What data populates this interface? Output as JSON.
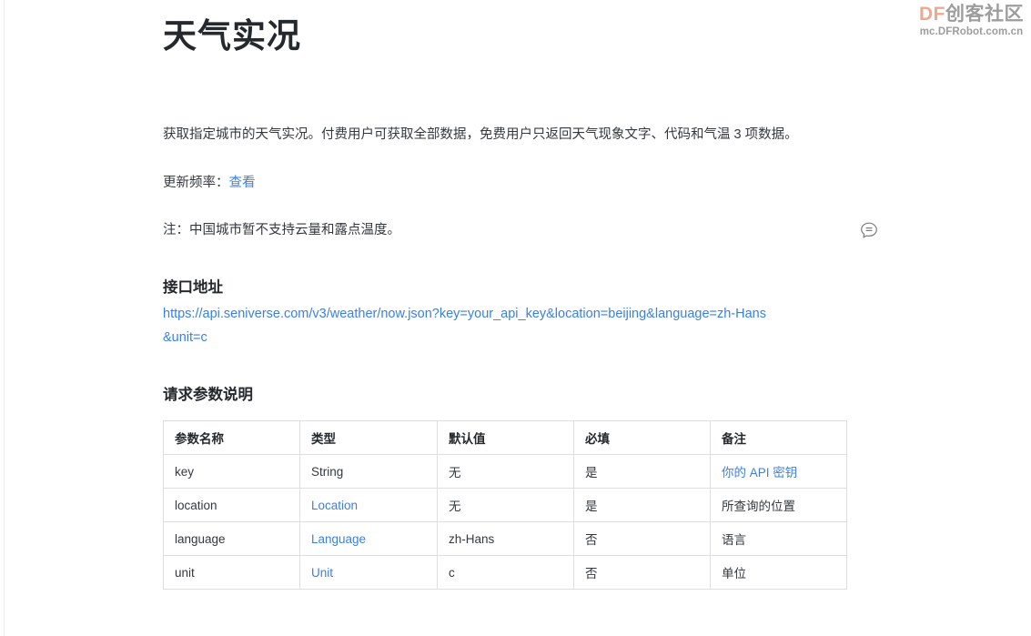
{
  "watermark": {
    "brand_df": "DF",
    "brand_cn": "创客社区",
    "site": "mc.DFRobot.com.cn",
    "df_color": "#eda98f",
    "cn_color": "#9d9d9d"
  },
  "doc": {
    "title": "天气实况",
    "intro": "获取指定城市的天气实况。付费用户可获取全部数据，免费用户只返回天气现象文字、代码和气温 3 项数据。",
    "frequency_label": "更新频率：",
    "frequency_link": "查看",
    "note": "注：中国城市暂不支持云量和露点温度。"
  },
  "endpoint": {
    "heading": "接口地址",
    "url": "https://api.seniverse.com/v3/weather/now.json?key=your_api_key&location=beijing&language=zh-Hans&unit=c",
    "link_color": "#3a7fe8"
  },
  "params": {
    "heading": "请求参数说明",
    "columns": [
      "参数名称",
      "类型",
      "默认值",
      "必填",
      "备注"
    ],
    "rows": [
      {
        "name": "key",
        "type": "String",
        "type_is_link": false,
        "default": "无",
        "required": "是",
        "remark": "你的 API 密钥",
        "remark_is_link": true
      },
      {
        "name": "location",
        "type": "Location",
        "type_is_link": true,
        "default": "无",
        "required": "是",
        "remark": "所查询的位置",
        "remark_is_link": false
      },
      {
        "name": "language",
        "type": "Language",
        "type_is_link": true,
        "default": "zh-Hans",
        "required": "否",
        "remark": "语言",
        "remark_is_link": false
      },
      {
        "name": "unit",
        "type": "Unit",
        "type_is_link": true,
        "default": "c",
        "required": "否",
        "remark": "单位",
        "remark_is_link": false
      }
    ]
  },
  "icons": {
    "comment": "comment-bubble-icon"
  }
}
